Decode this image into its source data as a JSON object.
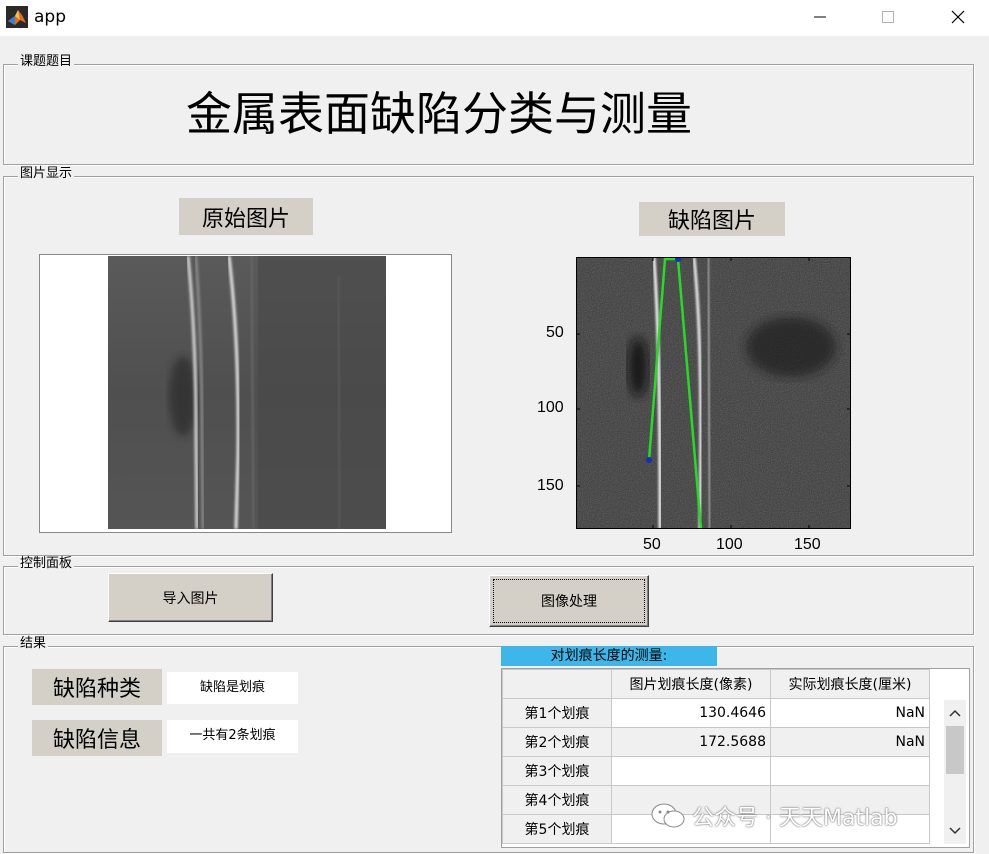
{
  "window": {
    "title": "app",
    "icon": "matlab-icon"
  },
  "panels": {
    "topic": "课题题目",
    "image_display": "图片显示",
    "control": "控制面板",
    "results": "结果"
  },
  "main_title": "金属表面缺陷分类与测量",
  "image_labels": {
    "original": "原始图片",
    "defect": "缺陷图片"
  },
  "axes": {
    "y_ticks": [
      "50",
      "100",
      "150"
    ],
    "x_ticks": [
      "50",
      "100",
      "150"
    ]
  },
  "buttons": {
    "import": "导入图片",
    "process": "图像处理"
  },
  "results": {
    "type_label": "缺陷种类",
    "type_value": "缺陷是划痕",
    "info_label": "缺陷信息",
    "info_value": "一共有2条划痕",
    "table_caption": "对划痕长度的测量:",
    "table_headers": [
      "",
      "图片划痕长度(像素)",
      "实际划痕长度(厘米)"
    ],
    "table_rows": [
      [
        "第1个划痕",
        "130.4646",
        "NaN"
      ],
      [
        "第2个划痕",
        "172.5688",
        "NaN"
      ],
      [
        "第3个划痕",
        "",
        ""
      ],
      [
        "第4个划痕",
        "",
        ""
      ],
      [
        "第5个划痕",
        "",
        ""
      ]
    ]
  },
  "watermark": "公众号 · 天天Matlab",
  "colors": {
    "caption_bg": "#3db7ea",
    "scratch_line": "#22dd22",
    "endpoint": "#1030c0"
  }
}
